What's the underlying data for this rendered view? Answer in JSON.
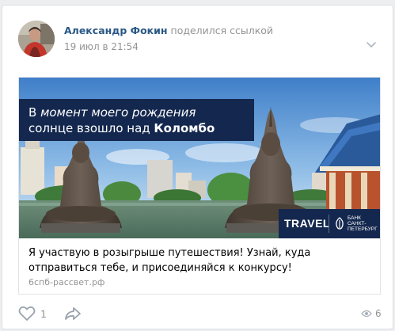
{
  "post": {
    "author": {
      "name": "Александр Фокин",
      "action": "поделился ссылкой"
    },
    "date": "19 июл в 21:54",
    "menu_icon": "chevron-down-icon",
    "link_card": {
      "banner": {
        "headline_line1_prefix": "В ",
        "headline_line1_italic": "момент моего рождения",
        "headline_line2_prefix": "солнце взошло над ",
        "headline_line2_bold": "Коломбо",
        "logo_travel": "TRAVEL",
        "logo_bank_line1": "БАНК",
        "logo_bank_line2": "САНКТ-",
        "logo_bank_line3": "ПЕТЕРБУРГ",
        "brand_color": "#14284f"
      },
      "title": "Я участвую в розыгрыше путешествия! Узнай, куда отправиться тебе, и присоединяйся к конкурсу!",
      "domain": "6спб-рассвет.рф"
    },
    "actions": {
      "like_icon": "heart-icon",
      "like_count": "1",
      "share_icon": "share-arrow-icon",
      "views_icon": "eye-icon",
      "views_count": "6"
    },
    "colors": {
      "link": "#2a5885",
      "muted": "#939393",
      "icon": "#99a2ad"
    }
  }
}
